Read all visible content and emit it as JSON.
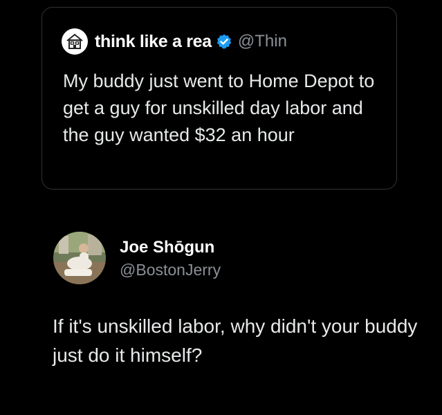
{
  "quoted_post": {
    "author_name": "think like a rea",
    "author_handle": "@Thin",
    "verified": true,
    "avatar_icon": "house-icon",
    "text": "My buddy just went to Home Depot to get a guy for unskilled day labor and the guy wanted $32 an hour"
  },
  "reply_post": {
    "author_name": "Joe Shōgun",
    "author_handle": "@BostonJerry",
    "avatar_icon": "profile-photo",
    "text": "If it's unskilled labor, why didn't your buddy just do it himself?"
  },
  "colors": {
    "background": "#000000",
    "text_primary": "#e7e9ea",
    "text_secondary": "#8b9096",
    "verified_badge": "#1d9bf0",
    "card_border": "#2f3336"
  }
}
